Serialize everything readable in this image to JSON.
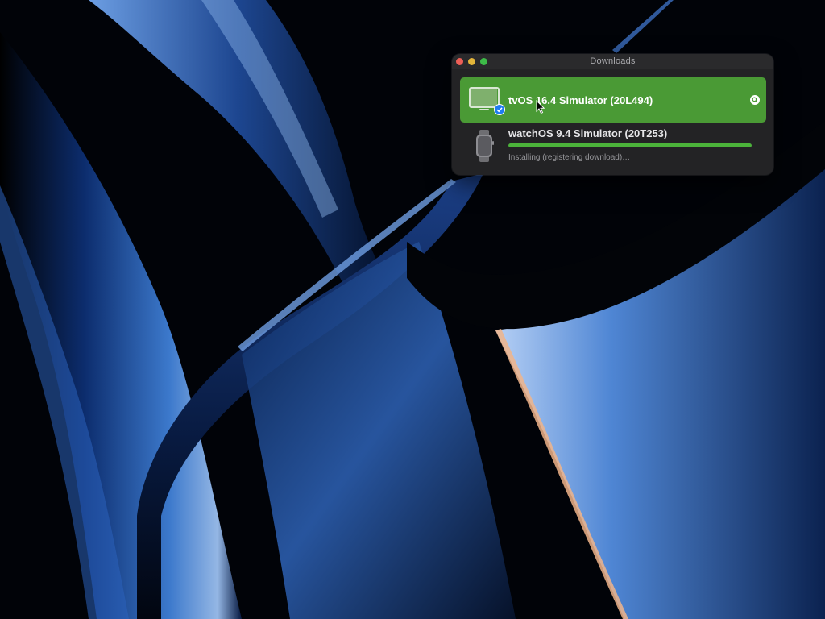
{
  "window": {
    "title": "Downloads"
  },
  "downloads": [
    {
      "title": "tvOS 16.4 Simulator (20L494)",
      "icon": "apple-tv-display-icon",
      "state": "completed",
      "selected": true
    },
    {
      "title": "watchOS 9.4 Simulator (20T253)",
      "icon": "apple-watch-icon",
      "state": "installing",
      "status": "Installing (registering download)…",
      "progress": 1.0
    }
  ],
  "colors": {
    "selection": "#4a9a35",
    "progress": "#4bb33a",
    "badge": "#1e7cf2"
  }
}
